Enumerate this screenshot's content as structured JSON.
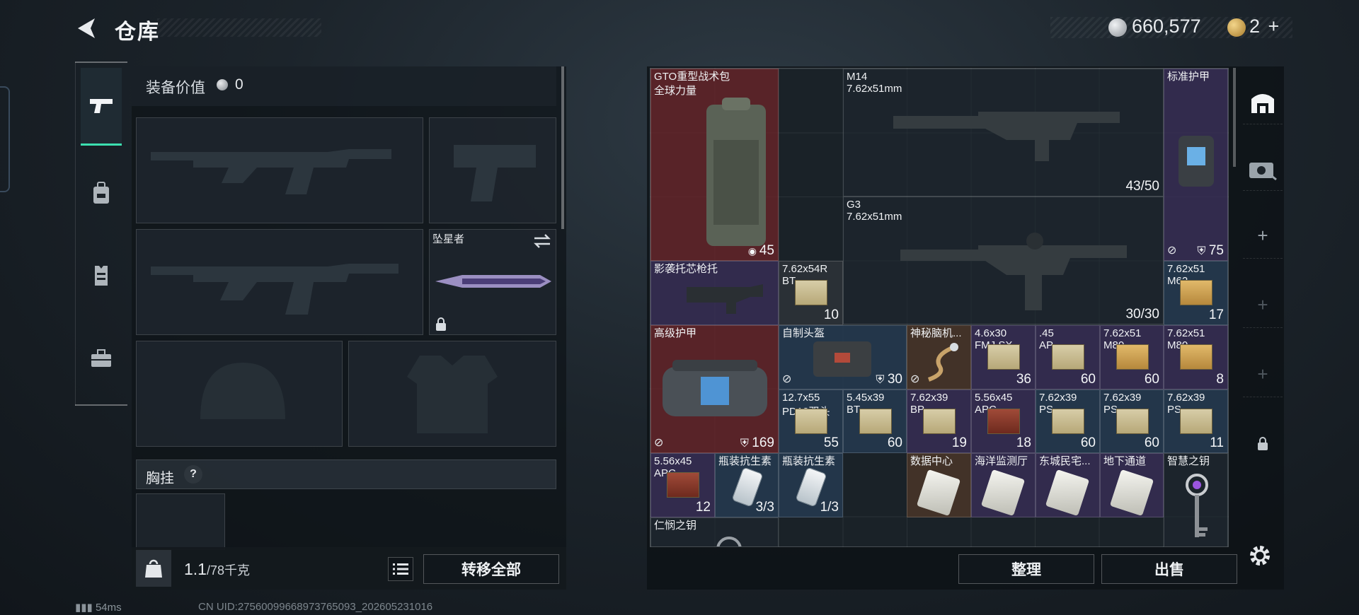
{
  "header": {
    "title": "仓库",
    "money": "660,577",
    "bonds": "2",
    "plus": "+"
  },
  "loadout": {
    "value_label": "装备价值",
    "value": "0",
    "melee_name": "坠星者",
    "chest_label": "胸挂",
    "help": "?",
    "weight": "1.1",
    "weight_max": "/78千克",
    "transfer_all": "转移全部"
  },
  "stash": {
    "items": [
      {
        "name": "GTO重型战术包",
        "sub": "全球力量",
        "count": "45"
      },
      {
        "name": "M14",
        "sub": "7.62x51mm",
        "count": "43/50"
      },
      {
        "name": "标准护甲",
        "count": "75"
      },
      {
        "name": "G3",
        "sub": "7.62x51mm",
        "count": "30/30"
      },
      {
        "name": "影袭托芯枪托"
      },
      {
        "name": "7.62x54R",
        "sub": "BT",
        "count": "10"
      },
      {
        "name": "7.62x51",
        "sub": "M62",
        "count": "17"
      },
      {
        "name": "高级护甲",
        "count": "169"
      },
      {
        "name": "自制头盔",
        "count": "30"
      },
      {
        "name": "神秘脑机..."
      },
      {
        "name": "4.6x30",
        "sub": "FMJ SX",
        "count": "36"
      },
      {
        "name": ".45",
        "sub": "AP",
        "count": "60"
      },
      {
        "name": "7.62x51",
        "sub": "M80",
        "count": "60"
      },
      {
        "name": "7.62x51",
        "sub": "M80",
        "count": "8"
      },
      {
        "name": "12.7x55",
        "sub": "PD12双头",
        "count": "55"
      },
      {
        "name": "5.45x39",
        "sub": "BT",
        "count": "60"
      },
      {
        "name": "7.62x39",
        "sub": "BP",
        "count": "19"
      },
      {
        "name": "5.56x45",
        "sub": "APC",
        "count": "18"
      },
      {
        "name": "7.62x39",
        "sub": "PS",
        "count": "60"
      },
      {
        "name": "7.62x39",
        "sub": "PS",
        "count": "60"
      },
      {
        "name": "7.62x39",
        "sub": "PS",
        "count": "11"
      },
      {
        "name": "5.56x45",
        "sub": "APC",
        "count": "12"
      },
      {
        "name": "瓶装抗生素",
        "count": "3/3"
      },
      {
        "name": "瓶装抗生素",
        "count": "1/3"
      },
      {
        "name": "数据中心"
      },
      {
        "name": "海洋监测厅"
      },
      {
        "name": "东城民宅..."
      },
      {
        "name": "地下通道"
      },
      {
        "name": "智慧之钥"
      },
      {
        "name": "仁悯之钥"
      }
    ],
    "sort_button": "整理",
    "sell_button": "出售"
  },
  "status": {
    "ping": "54ms",
    "uid": "CN UID:27560099668973765093_202605231016"
  },
  "colors": {
    "accent": "#3ce0b0",
    "red_quality": "#682428",
    "purple_quality": "#382e56",
    "blue_quality": "#263a50"
  },
  "icons": [
    "back-arrow-icon",
    "silver-coin-icon",
    "gold-bond-icon",
    "pistol-icon",
    "backpack-icon",
    "vest-icon",
    "toolbox-icon",
    "swap-icon",
    "lock-icon",
    "weight-bag-icon",
    "list-icon",
    "safe-box-icon",
    "case-icon",
    "plus-icon",
    "gear-icon",
    "armor-shield-icon",
    "no-repair-icon"
  ]
}
